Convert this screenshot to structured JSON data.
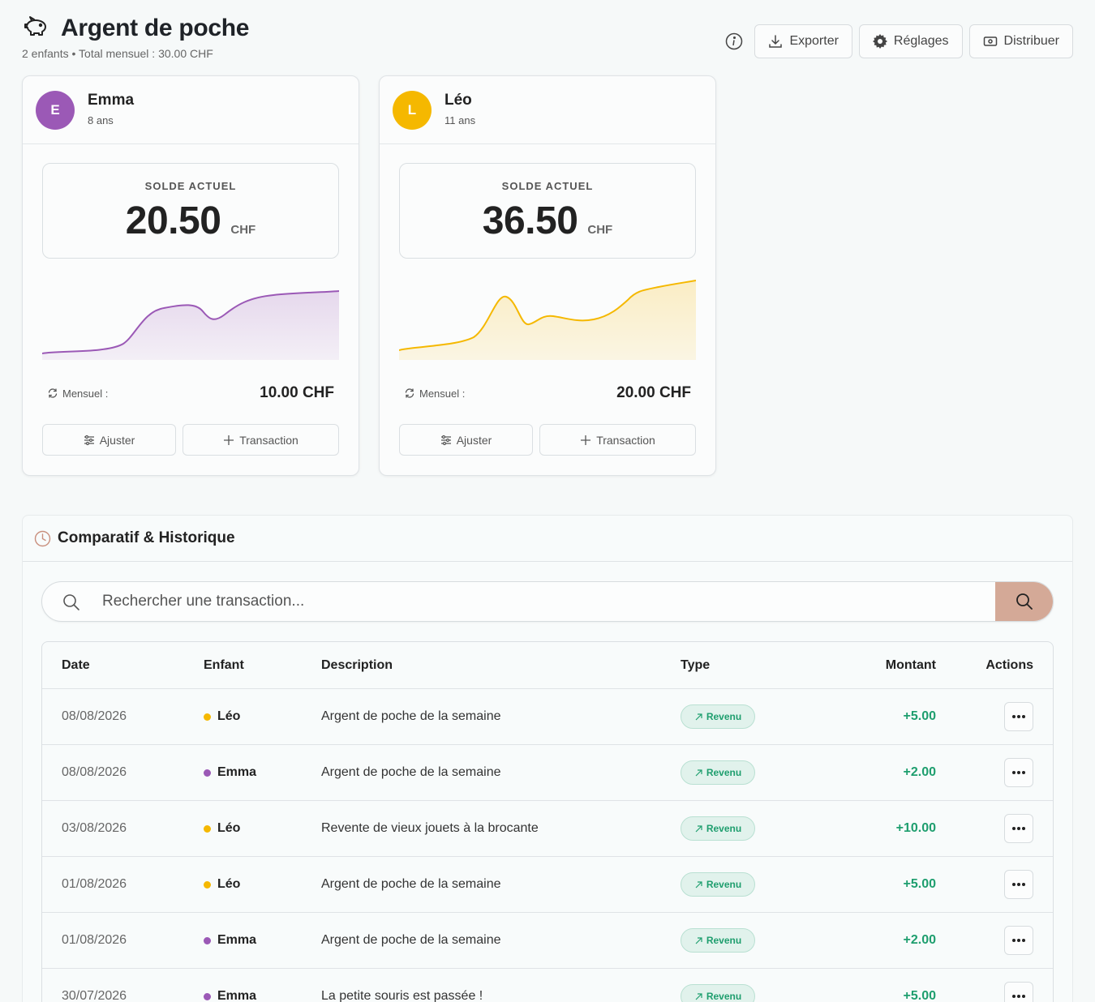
{
  "header": {
    "title": "Argent de poche",
    "subtitle": "2 enfants • Total mensuel : 30.00 CHF",
    "export_label": "Exporter",
    "settings_label": "Réglages",
    "distribute_label": "Distribuer"
  },
  "children": [
    {
      "initial": "E",
      "name": "Emma",
      "age": "8 ans",
      "color": "#9b59b6",
      "balance_label": "SOLDE ACTUEL",
      "balance": "20.50",
      "currency": "CHF",
      "monthly_label": "Mensuel :",
      "monthly_value": "10.00 CHF",
      "adjust_label": "Ajuster",
      "transaction_label": "Transaction"
    },
    {
      "initial": "L",
      "name": "Léo",
      "age": "11 ans",
      "color": "#f5b800",
      "balance_label": "SOLDE ACTUEL",
      "balance": "36.50",
      "currency": "CHF",
      "monthly_label": "Mensuel :",
      "monthly_value": "20.00 CHF",
      "adjust_label": "Ajuster",
      "transaction_label": "Transaction"
    }
  ],
  "history": {
    "title": "Comparatif & Historique",
    "search_placeholder": "Rechercher une transaction...",
    "columns": {
      "date": "Date",
      "child": "Enfant",
      "description": "Description",
      "type": "Type",
      "amount": "Montant",
      "actions": "Actions"
    },
    "rows": [
      {
        "date": "08/08/2026",
        "child": "Léo",
        "description": "Argent de poche de la semaine",
        "type": "Revenu",
        "amount": "+5.00"
      },
      {
        "date": "08/08/2026",
        "child": "Emma",
        "description": "Argent de poche de la semaine",
        "type": "Revenu",
        "amount": "+2.00"
      },
      {
        "date": "03/08/2026",
        "child": "Léo",
        "description": "Revente de vieux jouets à la brocante",
        "type": "Revenu",
        "amount": "+10.00"
      },
      {
        "date": "01/08/2026",
        "child": "Léo",
        "description": "Argent de poche de la semaine",
        "type": "Revenu",
        "amount": "+5.00"
      },
      {
        "date": "01/08/2026",
        "child": "Emma",
        "description": "Argent de poche de la semaine",
        "type": "Revenu",
        "amount": "+2.00"
      },
      {
        "date": "30/07/2026",
        "child": "Emma",
        "description": "La petite souris est passée !",
        "type": "Revenu",
        "amount": "+5.00"
      }
    ]
  },
  "colors": {
    "emma": "#9b59b6",
    "leo": "#f5b800",
    "income_green": "#1e9e6e",
    "search_button": "#d4a997"
  }
}
